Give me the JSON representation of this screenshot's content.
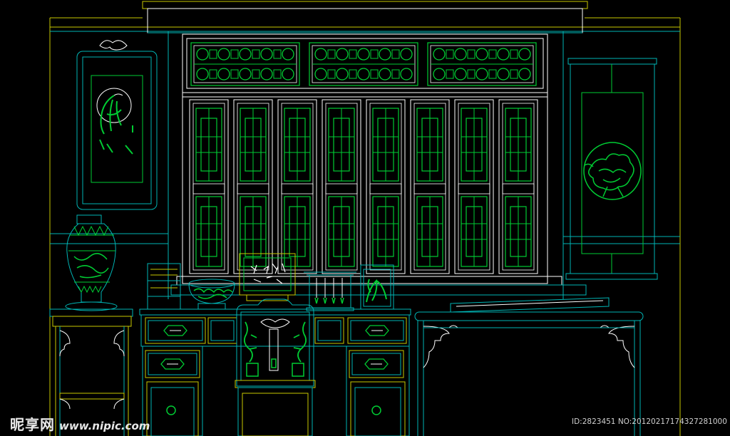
{
  "drawing": {
    "colors": {
      "background": "#000000",
      "primary_line": "#00cc33",
      "secondary_line": "#00b5b5",
      "accent_line": "#c8c800",
      "detail_line": "#ffffff"
    },
    "elements": [
      "top-cornice",
      "lattice-transom-panels",
      "lattice-window-doors",
      "bird-painting",
      "lotus-scroll",
      "porcelain-vase",
      "vase-stand",
      "book-stack",
      "carved-bowl",
      "calligraphy-screen",
      "brush-rack",
      "potted-plant",
      "writing-desk",
      "carved-chair",
      "qin-table",
      "guqin"
    ]
  },
  "watermark": {
    "site_name": "昵享网",
    "url": "www.nipic.com",
    "id_label": "ID:2823451 NO:20120217174327281000"
  }
}
